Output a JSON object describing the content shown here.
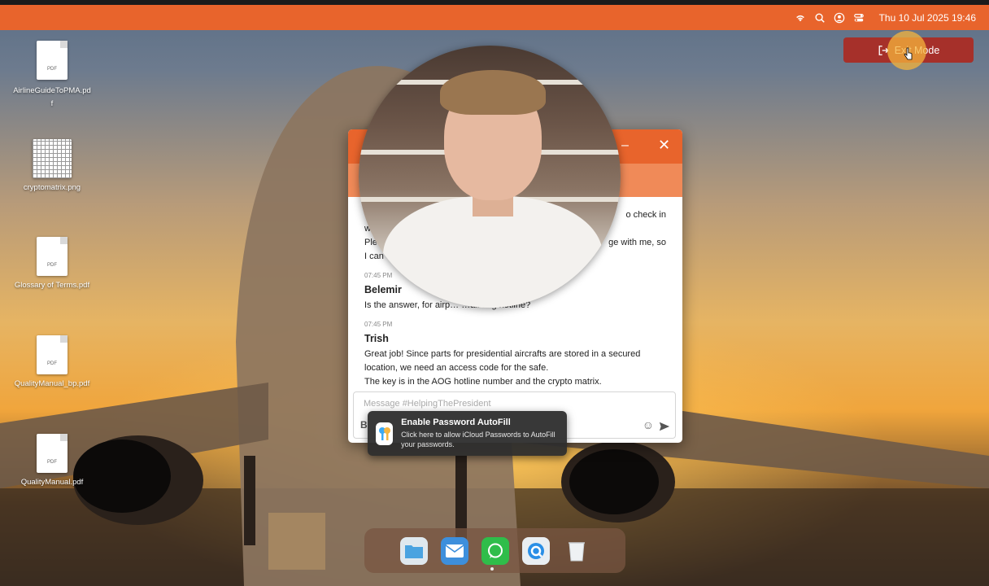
{
  "menubar": {
    "datetime": "Thu 10 Jul 2025 19:46",
    "icons": [
      "wifi-icon",
      "search-icon",
      "user-icon",
      "control-center-icon"
    ]
  },
  "desktop": {
    "files": [
      {
        "name": "AirlineGuideToPMA.pd\nf",
        "badge": "PDF",
        "kind": "pdf"
      },
      {
        "name": "cryptomatrix.png",
        "badge": "",
        "kind": "png"
      },
      {
        "name": "Glossary of Terms.pdf",
        "badge": "PDF",
        "kind": "pdf"
      },
      {
        "name": "QualityManual_bp.pdf",
        "badge": "PDF",
        "kind": "pdf"
      },
      {
        "name": "QualityManual.pdf",
        "badge": "PDF",
        "kind": "pdf"
      }
    ]
  },
  "exit_button": {
    "label": "Exit Mode"
  },
  "chat": {
    "messages_partial": {
      "line1_tail": "o check in",
      "line2_head": "w",
      "line3_head": "Ple",
      "line3_tail": "ge with me, so",
      "line4_head": "I can"
    },
    "messages": [
      {
        "time": "07:45 PM",
        "author": "Belemir",
        "text": "Is the answer, for airp… …all aog hotline?"
      },
      {
        "time": "07:45 PM",
        "author": "Trish",
        "lines": [
          "Great job! Since parts for presidential aircrafts are stored in a secured",
          "location, we need an access code for the safe.",
          "The key is in the AOG hotline number and the crypto matrix."
        ]
      }
    ],
    "composer": {
      "placeholder": "Message #HelpingThePresident",
      "bold_label": "B"
    }
  },
  "autofill": {
    "title": "Enable Password AutoFill",
    "description": "Click here to allow iCloud Passwords to AutoFill your passwords."
  },
  "dock": {
    "apps": [
      "files-icon",
      "mail-icon",
      "whatsapp-icon",
      "browser-icon",
      "trash-icon"
    ]
  },
  "colors": {
    "accent": "#e8642c",
    "exit_button": "#a6302a"
  }
}
